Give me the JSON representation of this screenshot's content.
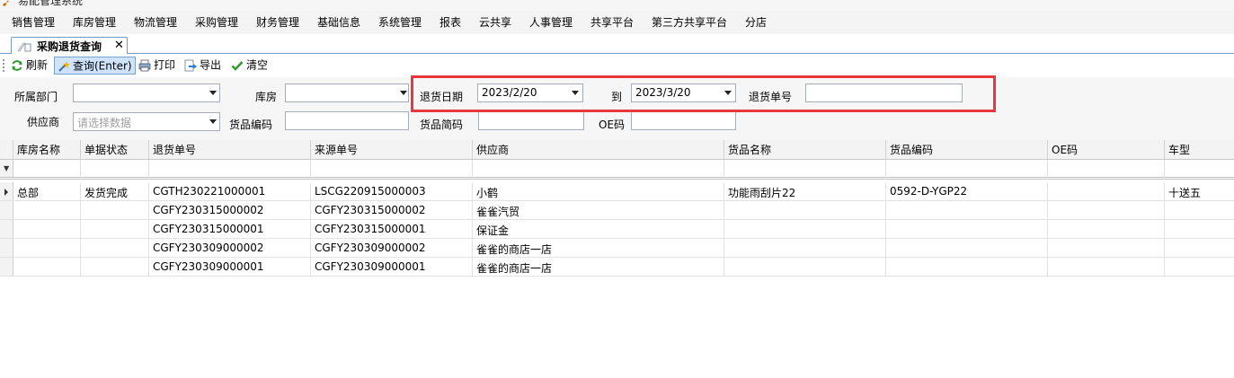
{
  "window": {
    "title": "易配管理系统"
  },
  "menu": [
    "销售管理",
    "库房管理",
    "物流管理",
    "采购管理",
    "财务管理",
    "基础信息",
    "系统管理",
    "报表",
    "云共享",
    "人事管理",
    "共享平台",
    "第三方共享平台",
    "分店"
  ],
  "tab": {
    "label": "采购退货查询",
    "close": "✕"
  },
  "toolbar": {
    "refresh": "刷新",
    "query": "查询(Enter)",
    "print": "打印",
    "export": "导出",
    "clear": "清空"
  },
  "filters": {
    "department": {
      "label": "所属部门",
      "value": ""
    },
    "warehouse": {
      "label": "库房",
      "value": ""
    },
    "return_date": {
      "label": "退货日期",
      "from": "2023/2/20",
      "to_label": "到",
      "to": "2023/3/20"
    },
    "return_no": {
      "label": "退货单号",
      "value": ""
    },
    "supplier": {
      "label": "供应商",
      "placeholder": "请选择数据"
    },
    "product_code": {
      "label": "货品编码",
      "value": ""
    },
    "product_short": {
      "label": "货品简码",
      "value": ""
    },
    "oe_code": {
      "label": "OE码",
      "value": ""
    }
  },
  "grid": {
    "columns": [
      "库房名称",
      "单据状态",
      "退货单号",
      "来源单号",
      "供应商",
      "货品名称",
      "货品编码",
      "OE码",
      "车型"
    ],
    "rows": [
      [
        "总部",
        "发货完成",
        "CGTH230221000001",
        "LSCG220915000003",
        "小鹤",
        "功能雨刮片22",
        "0592-D-YGP22",
        "",
        "十送五"
      ],
      [
        "",
        "",
        "CGFY230315000002",
        "CGFY230315000002",
        "雀雀汽贸",
        "",
        "",
        "",
        ""
      ],
      [
        "",
        "",
        "CGFY230315000001",
        "CGFY230315000001",
        "保证金",
        "",
        "",
        "",
        ""
      ],
      [
        "",
        "",
        "CGFY230309000002",
        "CGFY230309000002",
        "雀雀的商店一店",
        "",
        "",
        "",
        ""
      ],
      [
        "",
        "",
        "CGFY230309000001",
        "CGFY230309000001",
        "雀雀的商店一店",
        "",
        "",
        "",
        ""
      ]
    ]
  },
  "colors": {
    "highlight": "#e8383d",
    "tab_border": "#6f9bd1",
    "active_button": "#cfe3fc"
  }
}
